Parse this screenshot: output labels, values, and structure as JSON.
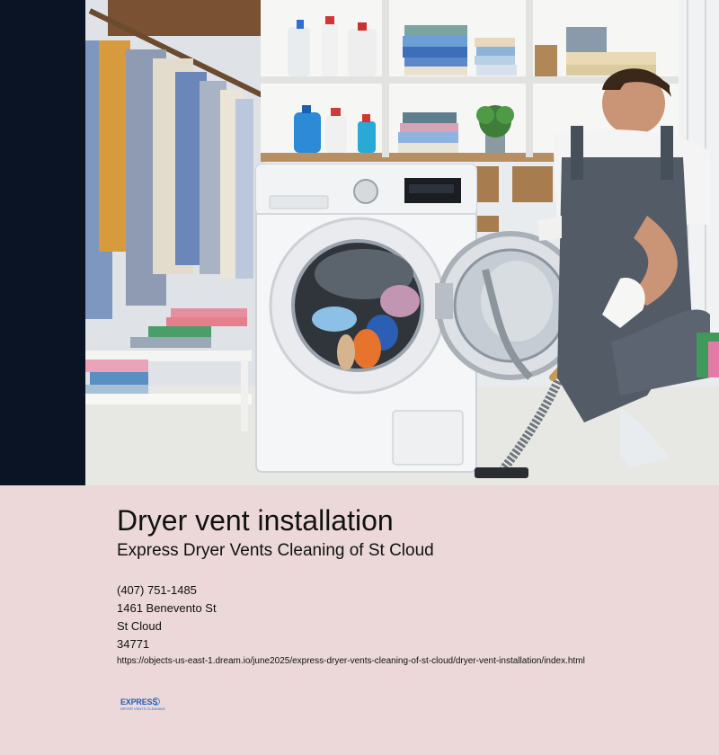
{
  "hero": {
    "alt": "Technician cleaning the dryer in a laundry room"
  },
  "page": {
    "title": "Dryer vent installation",
    "subtitle": "Express Dryer Vents Cleaning of St Cloud"
  },
  "contact": {
    "phone": "(407) 751-1485",
    "street": "1461 Benevento St",
    "city": "St Cloud",
    "zip": "34771",
    "url": "https://objects-us-east-1.dream.io/june2025/express-dryer-vents-cleaning-of-st-cloud/dryer-vent-installation/index.html"
  },
  "logo": {
    "top": "EXPRESS",
    "bottom": "DRYER VENTS CLEANING"
  },
  "colors": {
    "background": "#ecd8d8",
    "hero_left_band": "#0b1424",
    "logo_blue": "#1f5fb8"
  }
}
